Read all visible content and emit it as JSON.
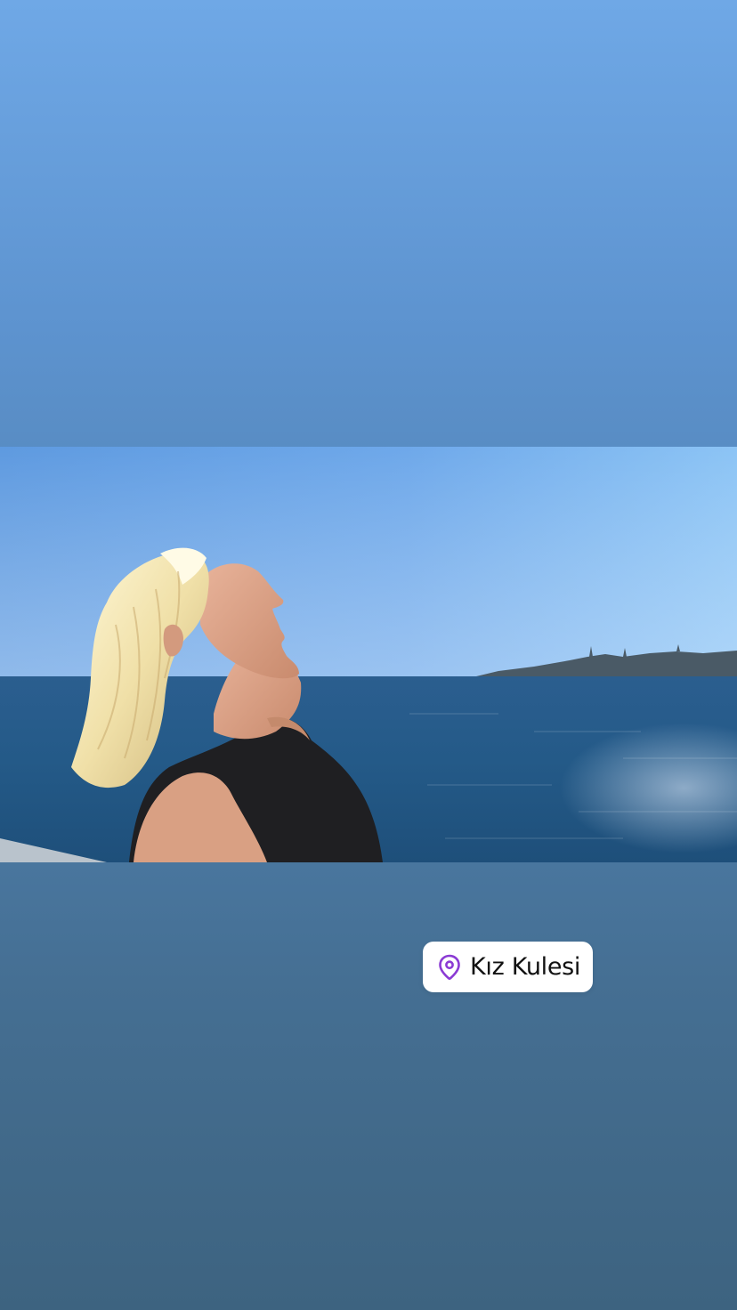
{
  "story": {
    "location_sticker": {
      "label": "Kız Kulesi",
      "icon": "location-pin-icon",
      "accent_color": "#8b3bd4"
    },
    "background_gradient": [
      "#6fa8e6",
      "#5d93cf",
      "#4e7eab",
      "#456f93",
      "#3d6380"
    ],
    "photo": {
      "subject": "woman-in-profile",
      "scene": "sea-shore"
    }
  }
}
